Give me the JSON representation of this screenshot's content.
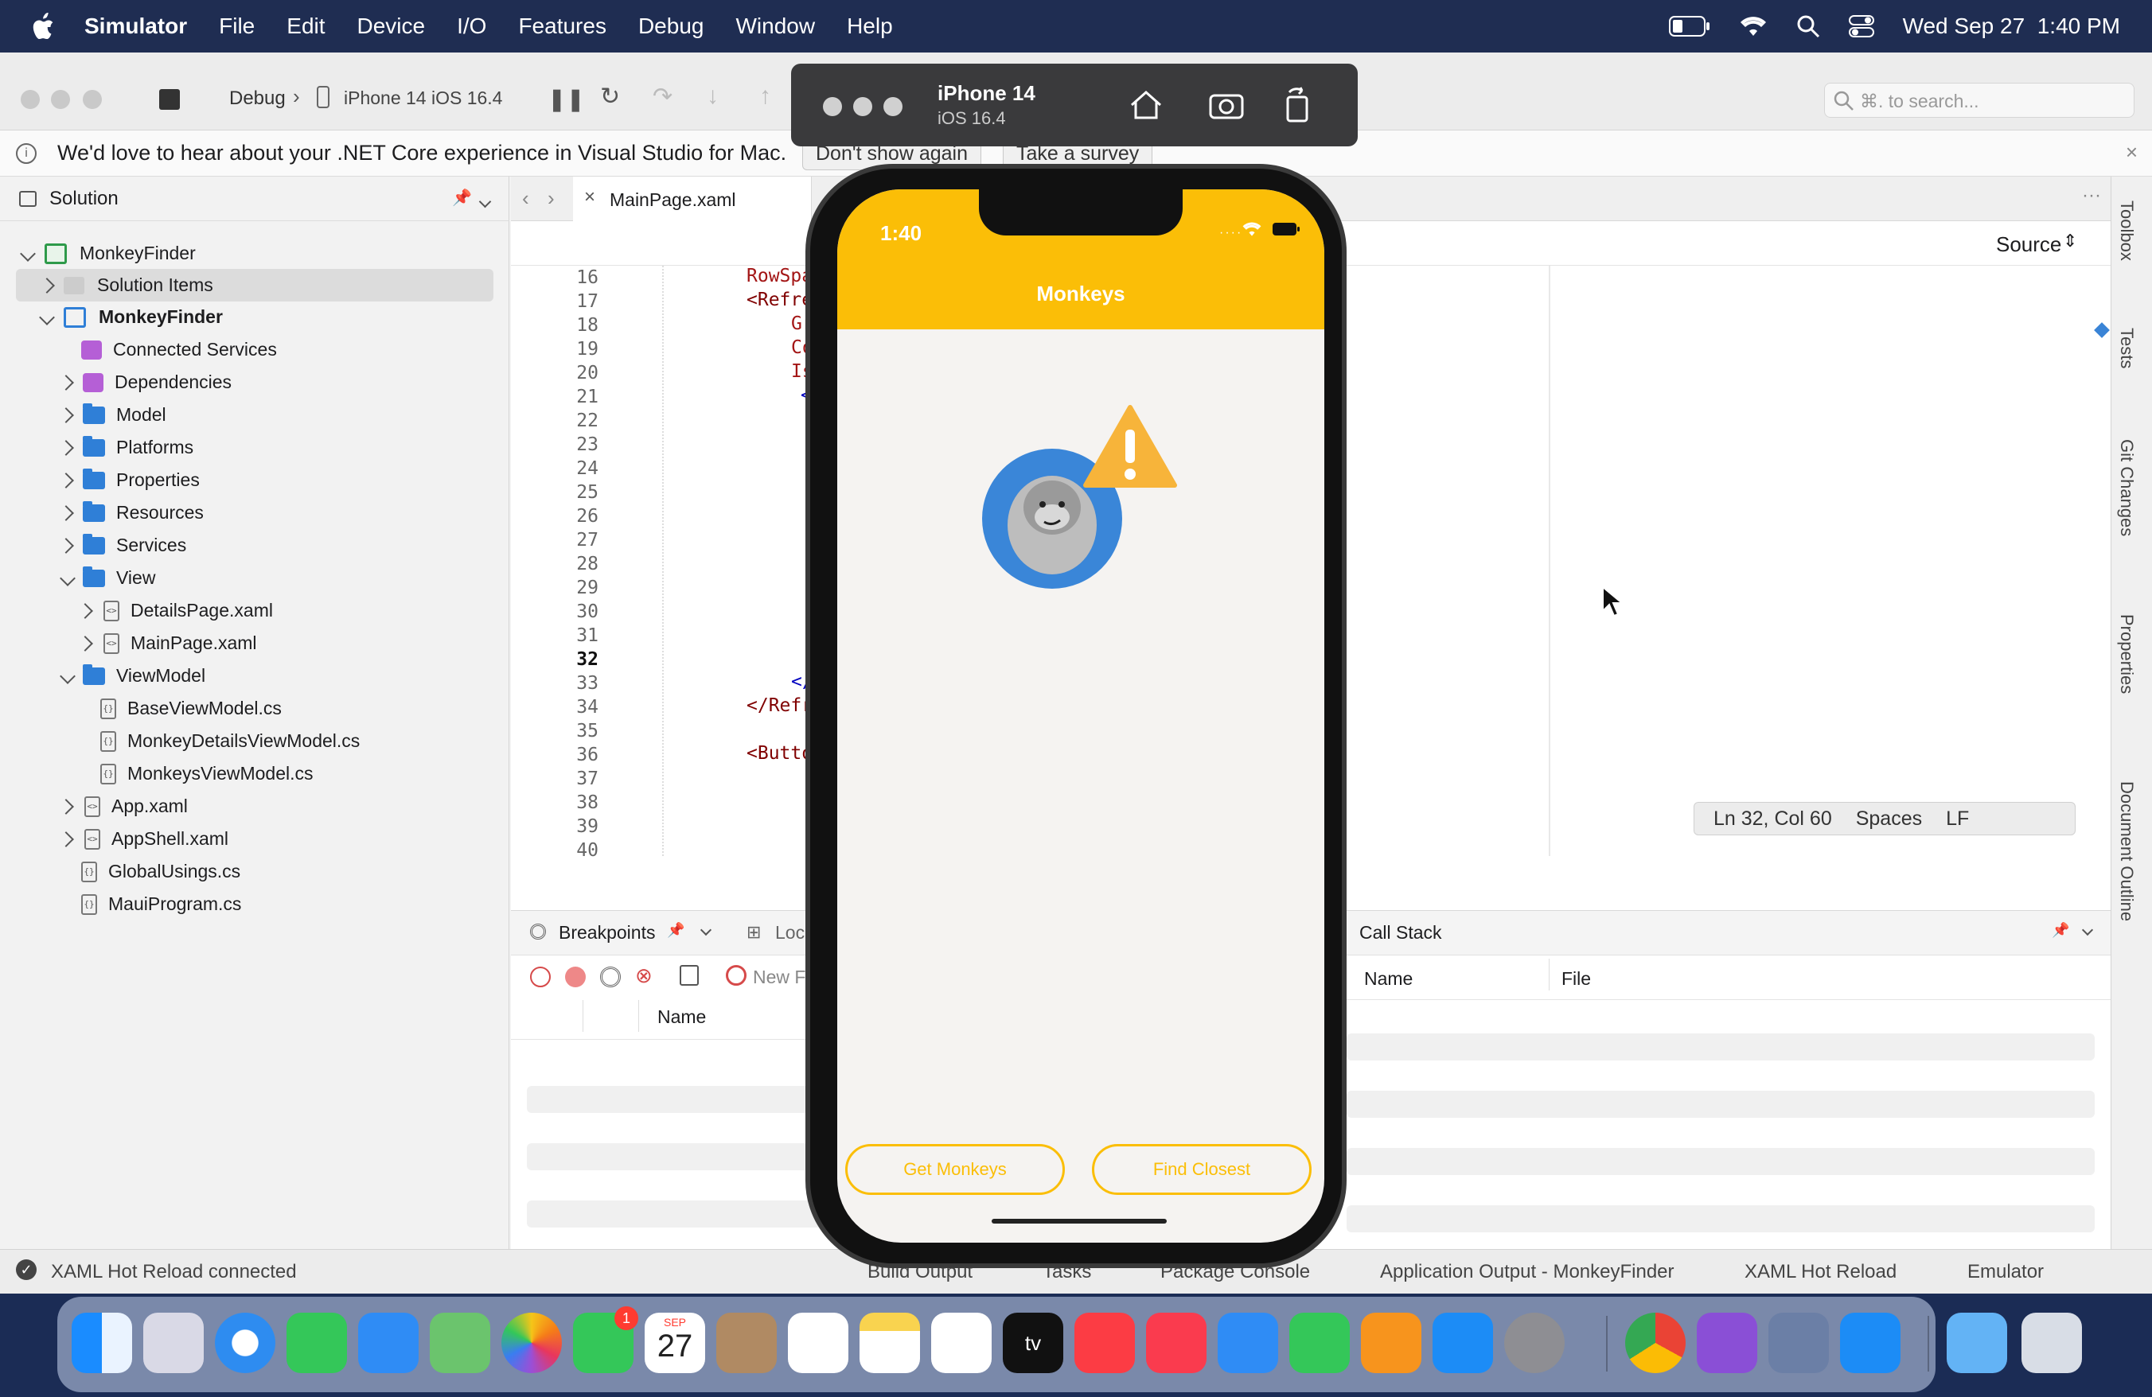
{
  "menubar": {
    "app_name": "Simulator",
    "items": [
      "File",
      "Edit",
      "Device",
      "I/O",
      "Features",
      "Debug",
      "Window",
      "Help"
    ],
    "datetime": "Wed Sep 27  1:40 PM"
  },
  "toolbar": {
    "config": "Debug",
    "device": "iPhone 14 iOS 16.4",
    "search_placeholder": "⌘. to search..."
  },
  "notice": {
    "text": "We'd love to hear about your .NET Core experience in Visual Studio for Mac.",
    "dont_show": "Don't show again",
    "survey": "Take a survey"
  },
  "solution": {
    "title": "Solution",
    "items": [
      {
        "label": "MonkeyFinder"
      },
      {
        "label": "Solution Items"
      },
      {
        "label": "MonkeyFinder"
      },
      {
        "label": "Connected Services"
      },
      {
        "label": "Dependencies"
      },
      {
        "label": "Model"
      },
      {
        "label": "Platforms"
      },
      {
        "label": "Properties"
      },
      {
        "label": "Resources"
      },
      {
        "label": "Services"
      },
      {
        "label": "View"
      },
      {
        "label": "DetailsPage.xaml"
      },
      {
        "label": "MainPage.xaml"
      },
      {
        "label": "ViewModel"
      },
      {
        "label": "BaseViewModel.cs"
      },
      {
        "label": "MonkeyDetailsViewModel.cs"
      },
      {
        "label": "MonkeysViewModel.cs"
      },
      {
        "label": "App.xaml"
      },
      {
        "label": "AppShell.xaml"
      },
      {
        "label": "GlobalUsings.cs"
      },
      {
        "label": "MauiProgram.cs"
      }
    ]
  },
  "editor": {
    "tab": "MainPage.xaml",
    "source_label": "Source",
    "line_numbers": [
      "16",
      "17",
      "18",
      "19",
      "20",
      "21",
      "22",
      "23",
      "24",
      "25",
      "26",
      "27",
      "28",
      "29",
      "30",
      "31",
      "32",
      "33",
      "34",
      "35",
      "36",
      "37",
      "38",
      "39",
      "40"
    ],
    "code_fragments": {
      "l16": "RowSpa",
      "l17": "<Refre",
      "l18": "Gr",
      "l19": "Co",
      "l20": "Is",
      "l21": "<",
      "l36": "</",
      "l37": "</Refr",
      "l39": "<Butto"
    },
    "cursor": "Ln 32, Col 60",
    "indent": "Spaces",
    "eol": "LF"
  },
  "right_tabs": [
    "Toolbox",
    "Tests",
    "Git Changes",
    "Properties",
    "Document Outline"
  ],
  "bottom": {
    "breakpoints_tab": "Breakpoints",
    "locals_tab": "Loc",
    "new_label": "New F",
    "name_col": "Name",
    "callstack_tab": "Call Stack",
    "cs_name_col": "Name",
    "cs_file_col": "File"
  },
  "status": {
    "hot_reload": "XAML Hot Reload connected",
    "tabs": [
      "Build Output",
      "Tasks",
      "Package Console",
      "Application Output - MonkeyFinder",
      "XAML Hot Reload",
      "Emulator"
    ]
  },
  "simulator": {
    "device": "iPhone 14",
    "os": "iOS 16.4"
  },
  "phone": {
    "time": "1:40",
    "title": "Monkeys",
    "button_get": "Get Monkeys",
    "button_find": "Find Closest"
  },
  "dock": {
    "calendar_month": "SEP",
    "calendar_day": "27",
    "facetime_badge": "1"
  }
}
